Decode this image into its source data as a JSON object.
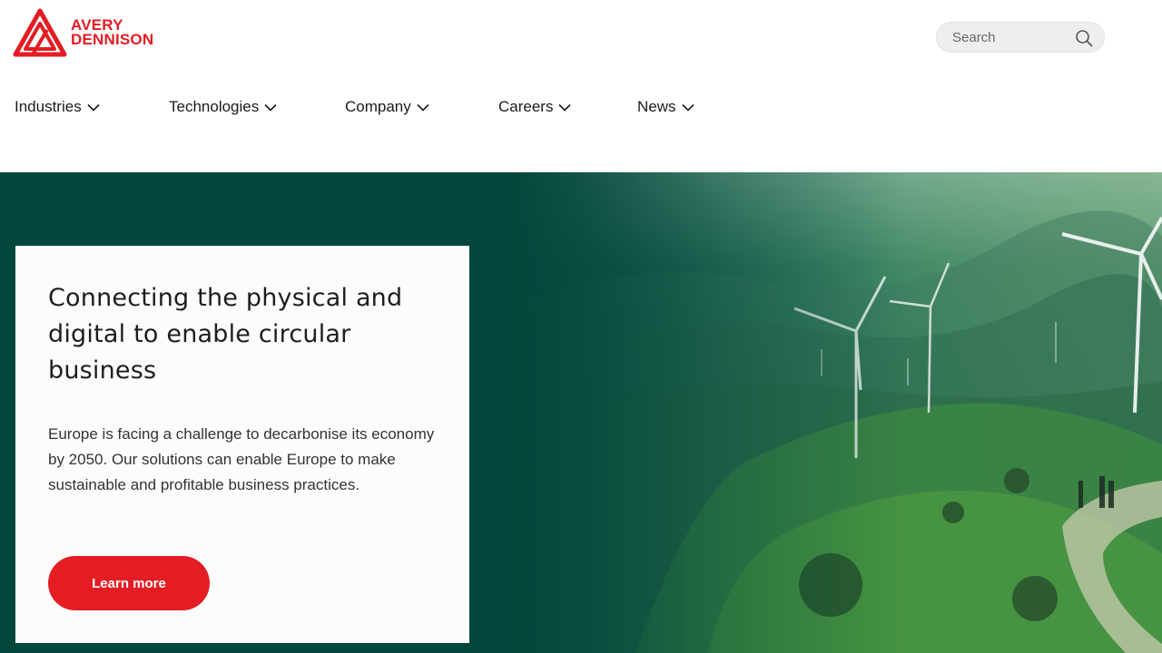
{
  "brand": {
    "line1": "AVERY",
    "line2": "DENNISON",
    "color": "#e31d23",
    "icon": "avery-dennison-logo-icon"
  },
  "search": {
    "placeholder": "Search",
    "value": "",
    "icon": "search-icon"
  },
  "nav": {
    "items": [
      {
        "label": "Industries"
      },
      {
        "label": "Technologies"
      },
      {
        "label": "Company"
      },
      {
        "label": "Careers"
      },
      {
        "label": "News"
      }
    ],
    "chevron_icon": "chevron-down-icon"
  },
  "hero": {
    "title": "Connecting the physical and digital to enable circular business",
    "body": "Europe is facing a challenge to decarbonise its economy by 2050. Our solutions can enable Europe to make sustainable and profitable business practices.",
    "cta_label": "Learn more",
    "background_color": "#03473c",
    "cta_color": "#e31d23"
  }
}
